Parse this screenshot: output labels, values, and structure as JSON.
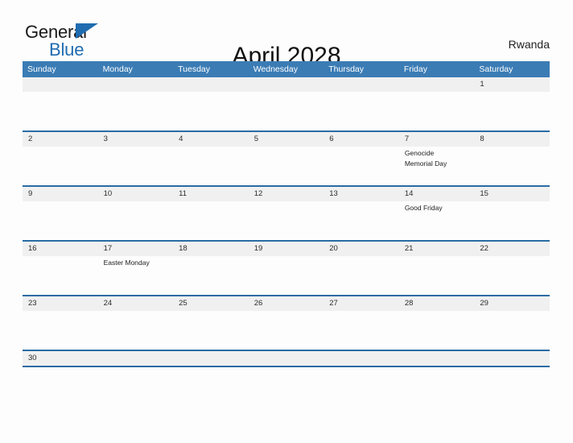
{
  "header": {
    "logo": {
      "word_one": "General",
      "word_two": "Blue",
      "triangle_icon": "triangle-icon"
    },
    "title": "April 2028",
    "country": "Rwanda"
  },
  "colors": {
    "header_blue": "#3b7cb5",
    "rule_blue": "#2b6ca3",
    "band_gray": "#f0f0f0",
    "logo_blue": "#1f6cb0",
    "page_background": "#fdfdfd"
  },
  "calendar": {
    "month": "April",
    "year": "2028",
    "day_names": [
      "Sunday",
      "Monday",
      "Tuesday",
      "Wednesday",
      "Thursday",
      "Friday",
      "Saturday"
    ],
    "weeks": [
      {
        "days": [
          {
            "date": "",
            "events": []
          },
          {
            "date": "",
            "events": []
          },
          {
            "date": "",
            "events": []
          },
          {
            "date": "",
            "events": []
          },
          {
            "date": "",
            "events": []
          },
          {
            "date": "",
            "events": []
          },
          {
            "date": "1",
            "events": []
          }
        ]
      },
      {
        "days": [
          {
            "date": "2",
            "events": []
          },
          {
            "date": "3",
            "events": []
          },
          {
            "date": "4",
            "events": []
          },
          {
            "date": "5",
            "events": []
          },
          {
            "date": "6",
            "events": []
          },
          {
            "date": "7",
            "events": [
              "Genocide",
              "Memorial Day"
            ]
          },
          {
            "date": "8",
            "events": []
          }
        ]
      },
      {
        "days": [
          {
            "date": "9",
            "events": []
          },
          {
            "date": "10",
            "events": []
          },
          {
            "date": "11",
            "events": []
          },
          {
            "date": "12",
            "events": []
          },
          {
            "date": "13",
            "events": []
          },
          {
            "date": "14",
            "events": [
              "Good Friday"
            ]
          },
          {
            "date": "15",
            "events": []
          }
        ]
      },
      {
        "days": [
          {
            "date": "16",
            "events": []
          },
          {
            "date": "17",
            "events": [
              "Easter Monday"
            ]
          },
          {
            "date": "18",
            "events": []
          },
          {
            "date": "19",
            "events": []
          },
          {
            "date": "20",
            "events": []
          },
          {
            "date": "21",
            "events": []
          },
          {
            "date": "22",
            "events": []
          }
        ]
      },
      {
        "days": [
          {
            "date": "23",
            "events": []
          },
          {
            "date": "24",
            "events": []
          },
          {
            "date": "25",
            "events": []
          },
          {
            "date": "26",
            "events": []
          },
          {
            "date": "27",
            "events": []
          },
          {
            "date": "28",
            "events": []
          },
          {
            "date": "29",
            "events": []
          }
        ]
      },
      {
        "days": [
          {
            "date": "30",
            "events": []
          },
          {
            "date": "",
            "events": []
          },
          {
            "date": "",
            "events": []
          },
          {
            "date": "",
            "events": []
          },
          {
            "date": "",
            "events": []
          },
          {
            "date": "",
            "events": []
          },
          {
            "date": "",
            "events": []
          }
        ],
        "no_event_band": true
      }
    ]
  }
}
